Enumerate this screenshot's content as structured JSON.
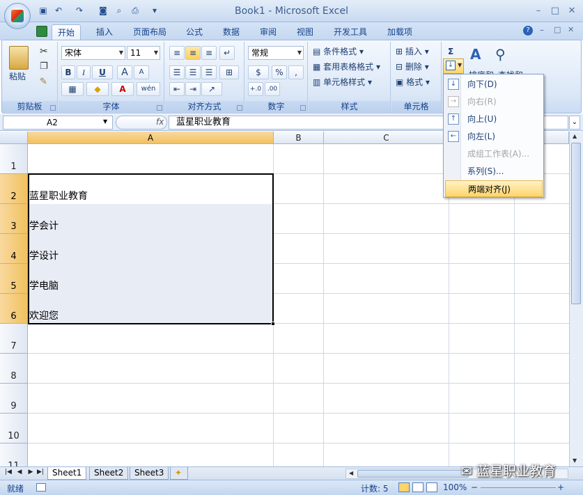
{
  "window": {
    "title": "Book1 - Microsoft Excel",
    "minimize": "–",
    "maximize": "□",
    "close": "✕"
  },
  "qat": {
    "save": "▣",
    "undo": "↶",
    "redo": "↷",
    "camera": "◙",
    "preview": "⌕",
    "print": "⎙",
    "more": "▾"
  },
  "tabs": [
    {
      "label": "开始"
    },
    {
      "label": "插入"
    },
    {
      "label": "页面布局"
    },
    {
      "label": "公式"
    },
    {
      "label": "数据"
    },
    {
      "label": "审阅"
    },
    {
      "label": "视图"
    },
    {
      "label": "开发工具"
    },
    {
      "label": "加载项"
    }
  ],
  "ribbon": {
    "clipboard": {
      "label": "剪贴板",
      "paste": "粘贴"
    },
    "font": {
      "label": "字体",
      "font_name": "宋体",
      "font_size": "11",
      "bold": "B",
      "italic": "I",
      "underline": "U",
      "grow": "A",
      "shrink": "A",
      "wen": "wén"
    },
    "alignment": {
      "label": "对齐方式"
    },
    "number": {
      "label": "数字",
      "format": "常规",
      "percent": "%",
      "comma": ","
    },
    "styles": {
      "label": "样式",
      "conditional": "条件格式",
      "table": "套用表格格式",
      "cell": "单元格样式"
    },
    "cells": {
      "label": "单元格",
      "insert": "插入",
      "delete": "删除",
      "format": "格式"
    },
    "editing": {
      "sigma": "Σ",
      "sort_filter": "排序和",
      "find_select": "查找和"
    }
  },
  "formula_bar": {
    "name_box": "A2",
    "fx": "fx",
    "value": "蓝星职业教育"
  },
  "columns": [
    "A",
    "B",
    "C"
  ],
  "rows": [
    "1",
    "2",
    "3",
    "4",
    "5",
    "6",
    "7",
    "8",
    "9",
    "10",
    "11"
  ],
  "cells": [
    "蓝星职业教育",
    "学会计",
    "学设计",
    "学电脑",
    "欢迎您"
  ],
  "fill_menu": [
    {
      "label": "向下(D)",
      "icon": "arrow-down-icon",
      "disabled": false
    },
    {
      "label": "向右(R)",
      "icon": "arrow-right-icon",
      "disabled": true
    },
    {
      "label": "向上(U)",
      "icon": "arrow-up-icon",
      "disabled": false
    },
    {
      "label": "向左(L)",
      "icon": "arrow-left-icon",
      "disabled": false
    },
    {
      "label": "成组工作表(A)...",
      "icon": "",
      "disabled": true
    },
    {
      "label": "系列(S)...",
      "icon": "",
      "disabled": false
    },
    {
      "label": "两端对齐(J)",
      "icon": "",
      "disabled": false
    }
  ],
  "sheets": [
    "Sheet1",
    "Sheet2",
    "Sheet3"
  ],
  "status": {
    "ready": "就绪",
    "count": "计数: 5",
    "zoom": "100%",
    "zoom_out": "−",
    "zoom_in": "+"
  },
  "watermark": "蓝星职业教育",
  "colors": {
    "selection": "#e8ecf5",
    "menu_hover": "#ffd56a",
    "header_sel": "#f1c15f"
  }
}
